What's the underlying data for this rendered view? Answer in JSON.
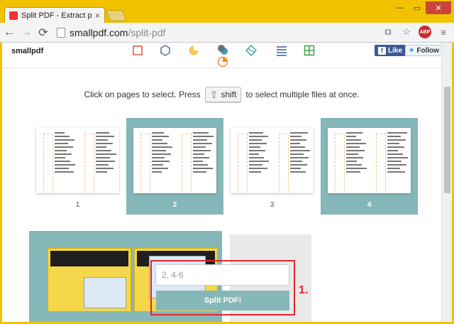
{
  "browser": {
    "tab_title": "Split PDF - Extract pages",
    "tab_close": "×",
    "url_host": "smallpdf.com",
    "url_path": "/split-pdf",
    "window_controls": {
      "minimize": "—",
      "maximize": "▭",
      "close": "✕"
    },
    "nav": {
      "back": "←",
      "forward": "→",
      "reload": "⟳"
    },
    "abp_label": "ABP"
  },
  "site": {
    "logo": "smallpdf",
    "tools": [
      "compress-icon",
      "convert-icon",
      "ppt-icon",
      "merge-icon",
      "split-icon",
      "list-icon",
      "grid-icon",
      "pie-icon"
    ],
    "facebook_like": "Like",
    "twitter_follow": "Follow"
  },
  "instruction": {
    "before": "Click on pages to select. Press",
    "key": "shift",
    "after": "to select multiple files at once."
  },
  "pages": [
    {
      "label": "1",
      "selected": false
    },
    {
      "label": "2",
      "selected": true
    },
    {
      "label": "3",
      "selected": false
    },
    {
      "label": "4",
      "selected": true
    }
  ],
  "split": {
    "input_placeholder": "2, 4-6",
    "button_label": "Split PDF!",
    "step_label": "1."
  },
  "colors": {
    "selected_bg": "#85b7b9",
    "highlight": "#e0262c",
    "chrome": "#f2c200"
  }
}
